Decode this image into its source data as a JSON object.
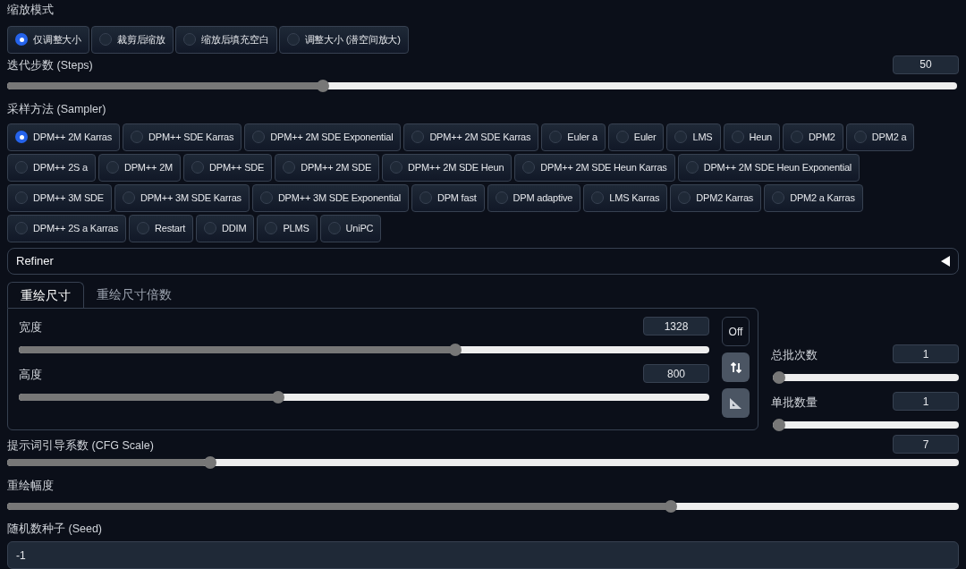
{
  "resize_mode": {
    "label": "缩放模式",
    "options": [
      {
        "label": "仅调整大小",
        "selected": true
      },
      {
        "label": "裁剪后缩放",
        "selected": false
      },
      {
        "label": "缩放后填充空白",
        "selected": false
      },
      {
        "label": "调整大小 (潜空间放大)",
        "selected": false
      }
    ]
  },
  "steps": {
    "label": "迭代步数 (Steps)",
    "value": "50",
    "level": 0.33
  },
  "sampler": {
    "label": "采样方法 (Sampler)",
    "options": [
      {
        "label": "DPM++ 2M Karras",
        "selected": true
      },
      {
        "label": "DPM++ SDE Karras",
        "selected": false
      },
      {
        "label": "DPM++ 2M SDE Exponential",
        "selected": false
      },
      {
        "label": "DPM++ 2M SDE Karras",
        "selected": false
      },
      {
        "label": "Euler a",
        "selected": false
      },
      {
        "label": "Euler",
        "selected": false
      },
      {
        "label": "LMS",
        "selected": false
      },
      {
        "label": "Heun",
        "selected": false
      },
      {
        "label": "DPM2",
        "selected": false
      },
      {
        "label": "DPM2 a",
        "selected": false
      },
      {
        "label": "DPM++ 2S a",
        "selected": false
      },
      {
        "label": "DPM++ 2M",
        "selected": false
      },
      {
        "label": "DPM++ SDE",
        "selected": false
      },
      {
        "label": "DPM++ 2M SDE",
        "selected": false
      },
      {
        "label": "DPM++ 2M SDE Heun",
        "selected": false
      },
      {
        "label": "DPM++ 2M SDE Heun Karras",
        "selected": false
      },
      {
        "label": "DPM++ 2M SDE Heun Exponential",
        "selected": false
      },
      {
        "label": "DPM++ 3M SDE",
        "selected": false
      },
      {
        "label": "DPM++ 3M SDE Karras",
        "selected": false
      },
      {
        "label": "DPM++ 3M SDE Exponential",
        "selected": false
      },
      {
        "label": "DPM fast",
        "selected": false
      },
      {
        "label": "DPM adaptive",
        "selected": false
      },
      {
        "label": "LMS Karras",
        "selected": false
      },
      {
        "label": "DPM2 Karras",
        "selected": false
      },
      {
        "label": "DPM2 a Karras",
        "selected": false
      },
      {
        "label": "DPM++ 2S a Karras",
        "selected": false
      },
      {
        "label": "Restart",
        "selected": false
      },
      {
        "label": "DDIM",
        "selected": false
      },
      {
        "label": "PLMS",
        "selected": false
      },
      {
        "label": "UniPC",
        "selected": false
      }
    ]
  },
  "refiner": {
    "label": "Refiner",
    "expanded": false
  },
  "size_tabs": [
    {
      "label": "重绘尺寸",
      "selected": true
    },
    {
      "label": "重绘尺寸倍数",
      "selected": false
    }
  ],
  "width": {
    "label": "宽度",
    "value": "1328",
    "level": 0.635
  },
  "height": {
    "label": "高度",
    "value": "800",
    "level": 0.373
  },
  "aspect_lock": {
    "label": "Off"
  },
  "batch_count": {
    "label": "总批次数",
    "value": "1",
    "level": 0
  },
  "batch_size": {
    "label": "单批数量",
    "value": "1",
    "level": 0
  },
  "cfg_scale": {
    "label": "提示词引导系数 (CFG Scale)",
    "value": "7",
    "level": 0.21
  },
  "denoising": {
    "label": "重绘幅度",
    "level": 0.7
  },
  "seed": {
    "label": "随机数种子 (Seed)",
    "value": "-1"
  }
}
